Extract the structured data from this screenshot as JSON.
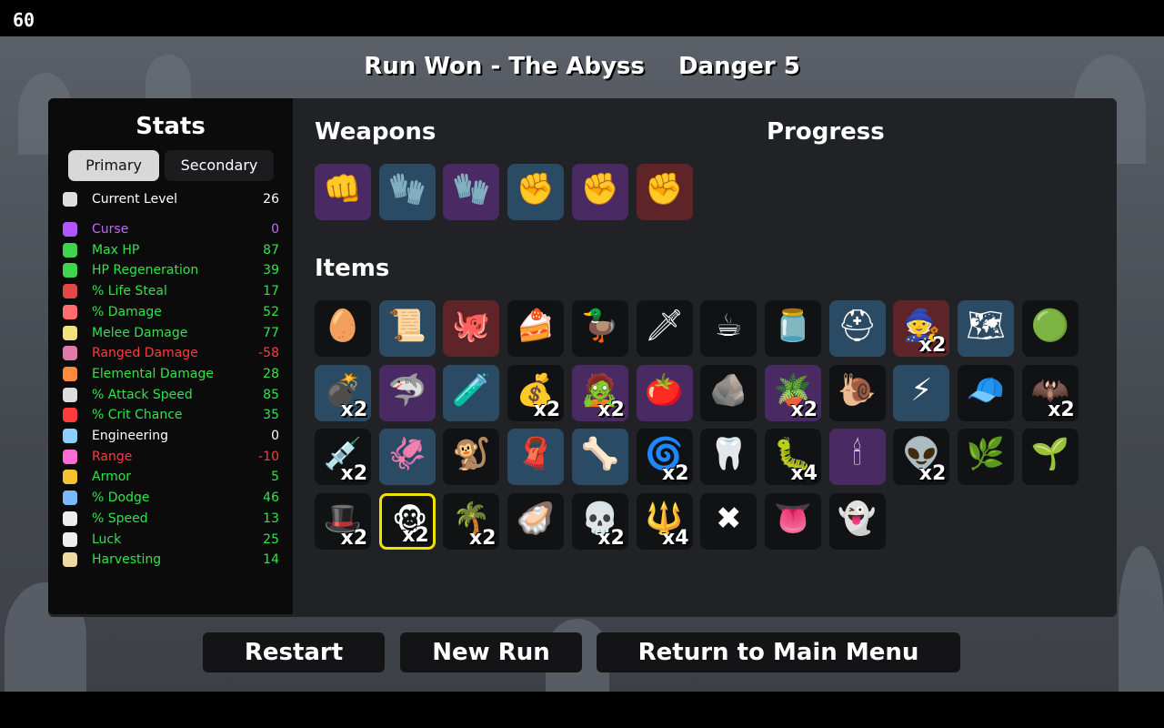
{
  "fps": "60",
  "header": {
    "run_status": "Run Won - The Abyss",
    "danger": "Danger 5"
  },
  "stats": {
    "title": "Stats",
    "tabs": {
      "primary": "Primary",
      "secondary": "Secondary"
    },
    "rows": [
      {
        "label": "Current Level",
        "value": "26",
        "color": "white",
        "icon": "level-icon"
      },
      {
        "label": "Curse",
        "value": "0",
        "color": "purple",
        "icon": "curse-icon"
      },
      {
        "label": "Max HP",
        "value": "87",
        "color": "green",
        "icon": "heart-icon"
      },
      {
        "label": "HP Regeneration",
        "value": "39",
        "color": "green",
        "icon": "regen-heart-icon"
      },
      {
        "label": "% Life Steal",
        "value": "17",
        "color": "green",
        "icon": "fangs-icon"
      },
      {
        "label": "% Damage",
        "value": "52",
        "color": "green",
        "icon": "muscle-icon"
      },
      {
        "label": "Melee Damage",
        "value": "77",
        "color": "green",
        "icon": "sword-icon"
      },
      {
        "label": "Ranged Damage",
        "value": "-58",
        "color": "red",
        "icon": "bow-icon"
      },
      {
        "label": "Elemental Damage",
        "value": "28",
        "color": "green",
        "icon": "flame-icon"
      },
      {
        "label": "% Attack Speed",
        "value": "85",
        "color": "green",
        "icon": "hourglass-icon"
      },
      {
        "label": "% Crit Chance",
        "value": "35",
        "color": "green",
        "icon": "crit-star-icon"
      },
      {
        "label": "Engineering",
        "value": "0",
        "color": "white",
        "icon": "wrench-icon"
      },
      {
        "label": "Range",
        "value": "-10",
        "color": "red",
        "icon": "range-icon"
      },
      {
        "label": "Armor",
        "value": "5",
        "color": "green",
        "icon": "shield-icon"
      },
      {
        "label": "% Dodge",
        "value": "46",
        "color": "green",
        "icon": "dodge-icon"
      },
      {
        "label": "% Speed",
        "value": "13",
        "color": "green",
        "icon": "boot-icon"
      },
      {
        "label": "Luck",
        "value": "25",
        "color": "green",
        "icon": "dice-icon"
      },
      {
        "label": "Harvesting",
        "value": "14",
        "color": "green",
        "icon": "wheat-icon"
      }
    ]
  },
  "weapons": {
    "title": "Weapons",
    "items": [
      {
        "name": "flaming-fist-icon",
        "glyph": "👊",
        "bg": "purplebg"
      },
      {
        "name": "claw-glove-icon",
        "glyph": "🧤",
        "bg": "blue"
      },
      {
        "name": "claw-glove-icon",
        "glyph": "🧤",
        "bg": "purplebg"
      },
      {
        "name": "fist-icon",
        "glyph": "✊",
        "bg": "blue"
      },
      {
        "name": "fist-icon",
        "glyph": "✊",
        "bg": "purplebg"
      },
      {
        "name": "fist-icon",
        "glyph": "✊",
        "bg": "redbg"
      }
    ]
  },
  "progress": {
    "title": "Progress"
  },
  "items": {
    "title": "Items",
    "list": [
      {
        "name": "egg-icon",
        "glyph": "🥚",
        "bg": "",
        "qty": ""
      },
      {
        "name": "scroll-icon",
        "glyph": "📜",
        "bg": "blue",
        "qty": ""
      },
      {
        "name": "octopus-icon",
        "glyph": "🐙",
        "bg": "redbg",
        "qty": ""
      },
      {
        "name": "cake-icon",
        "glyph": "🍰",
        "bg": "",
        "qty": ""
      },
      {
        "name": "duck-icon",
        "glyph": "🦆",
        "bg": "",
        "qty": ""
      },
      {
        "name": "spear-creature-icon",
        "glyph": "🗡",
        "bg": "",
        "qty": ""
      },
      {
        "name": "coffee-icon",
        "glyph": "☕",
        "bg": "",
        "qty": ""
      },
      {
        "name": "jar-icon",
        "glyph": "🫙",
        "bg": "",
        "qty": ""
      },
      {
        "name": "helmet-icon",
        "glyph": "⛑",
        "bg": "blue",
        "qty": ""
      },
      {
        "name": "gnome-icon",
        "glyph": "🧙",
        "bg": "redbg",
        "qty": "x2"
      },
      {
        "name": "treasure-map-icon",
        "glyph": "🗺",
        "bg": "blue",
        "qty": ""
      },
      {
        "name": "slime-icon",
        "glyph": "🟢",
        "bg": "",
        "qty": ""
      },
      {
        "name": "bomb-icon",
        "glyph": "💣",
        "bg": "blue",
        "qty": "x2"
      },
      {
        "name": "fin-icon",
        "glyph": "🦈",
        "bg": "purplebg",
        "qty": ""
      },
      {
        "name": "potion-icon",
        "glyph": "🧪",
        "bg": "blue",
        "qty": ""
      },
      {
        "name": "sack-icon",
        "glyph": "💰",
        "bg": "",
        "qty": "x2"
      },
      {
        "name": "zombie-icon",
        "glyph": "🧟",
        "bg": "purplebg",
        "qty": "x2"
      },
      {
        "name": "tomato-icon",
        "glyph": "🍅",
        "bg": "purplebg",
        "qty": ""
      },
      {
        "name": "rock-icon",
        "glyph": "🪨",
        "bg": "",
        "qty": ""
      },
      {
        "name": "plant-pot-icon",
        "glyph": "🪴",
        "bg": "purplebg",
        "qty": "x2"
      },
      {
        "name": "snail-icon",
        "glyph": "🐌",
        "bg": "",
        "qty": ""
      },
      {
        "name": "lightning-icon",
        "glyph": "⚡",
        "bg": "blue",
        "qty": ""
      },
      {
        "name": "propeller-cap-icon",
        "glyph": "🧢",
        "bg": "",
        "qty": ""
      },
      {
        "name": "bat-icon",
        "glyph": "🦇",
        "bg": "",
        "qty": "x2"
      },
      {
        "name": "syringe-icon",
        "glyph": "💉",
        "bg": "",
        "qty": "x2"
      },
      {
        "name": "squid-icon",
        "glyph": "🦑",
        "bg": "blue",
        "qty": ""
      },
      {
        "name": "monkey-icon",
        "glyph": "🐒",
        "bg": "",
        "qty": ""
      },
      {
        "name": "scarf-icon",
        "glyph": "🧣",
        "bg": "blue",
        "qty": ""
      },
      {
        "name": "cast-icon",
        "glyph": "🦴",
        "bg": "blue",
        "qty": ""
      },
      {
        "name": "red-swirl-icon",
        "glyph": "🌀",
        "bg": "",
        "qty": "x2"
      },
      {
        "name": "tooth-icon",
        "glyph": "🦷",
        "bg": "",
        "qty": ""
      },
      {
        "name": "leech-icon",
        "glyph": "🐛",
        "bg": "",
        "qty": "x4"
      },
      {
        "name": "lamp-machine-icon",
        "glyph": "🕯",
        "bg": "purplebg",
        "qty": ""
      },
      {
        "name": "alien-icon",
        "glyph": "👽",
        "bg": "",
        "qty": "x2"
      },
      {
        "name": "seed-bag-icon",
        "glyph": "🌿",
        "bg": "",
        "qty": ""
      },
      {
        "name": "sprout-icon",
        "glyph": "🌱",
        "bg": "",
        "qty": ""
      },
      {
        "name": "beanie-icon",
        "glyph": "🎩",
        "bg": "",
        "qty": "x2"
      },
      {
        "name": "monkey-doll-icon",
        "glyph": "🐵",
        "bg": "",
        "qty": "x2",
        "selected": true
      },
      {
        "name": "palm-tree-icon",
        "glyph": "🌴",
        "bg": "",
        "qty": "x2"
      },
      {
        "name": "hooded-creature-icon",
        "glyph": "🦪",
        "bg": "",
        "qty": ""
      },
      {
        "name": "skull-horn-icon",
        "glyph": "💀",
        "bg": "",
        "qty": "x2"
      },
      {
        "name": "injector-icon",
        "glyph": "🔱",
        "bg": "",
        "qty": "x4"
      },
      {
        "name": "red-crossbones-icon",
        "glyph": "✖",
        "bg": "",
        "qty": ""
      },
      {
        "name": "tongue-icon",
        "glyph": "👅",
        "bg": "",
        "qty": ""
      },
      {
        "name": "ghost-face-icon",
        "glyph": "👻",
        "bg": "",
        "qty": ""
      }
    ]
  },
  "buttons": {
    "restart": "Restart",
    "new_run": "New Run",
    "main_menu": "Return to Main Menu"
  }
}
